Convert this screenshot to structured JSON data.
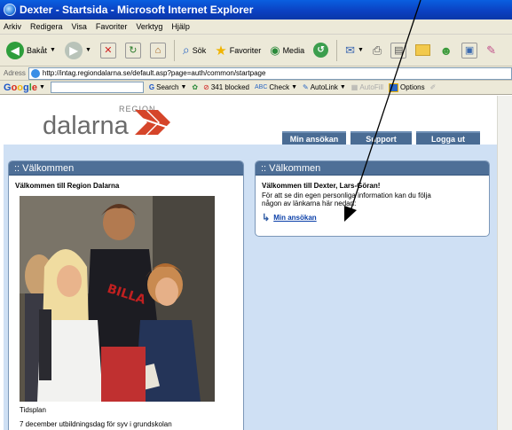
{
  "window": {
    "title": "Dexter - Startsida - Microsoft Internet Explorer"
  },
  "menu": [
    "Arkiv",
    "Redigera",
    "Visa",
    "Favoriter",
    "Verktyg",
    "Hjälp"
  ],
  "toolbar": {
    "back_label": "Bakåt",
    "search_label": "Sök",
    "favorites_label": "Favoriter",
    "media_label": "Media"
  },
  "address": {
    "label": "Adress",
    "url": "http://intag.regiondalarna.se/default.asp?page=auth/common/startpage"
  },
  "google_toolbar": {
    "logo": "Google",
    "search_label": "Search",
    "blocked_label": "341 blocked",
    "check_label": "Check",
    "autolink_label": "AutoLink",
    "autofill_label": "AutoFill",
    "options_label": "Options"
  },
  "site": {
    "logo_region": "REGION",
    "logo_name": "dalarna",
    "brand_color": "#d5452a",
    "nav": [
      "Min ansökan",
      "Support",
      "Logga ut"
    ]
  },
  "left_panel": {
    "title": ":: Välkommen",
    "heading": "Välkommen till Region Dalarna",
    "caption_1": "Tidsplan",
    "caption_2": "7 december utbildningsdag för syv i grundskolan"
  },
  "right_panel": {
    "title": ":: Välkommen",
    "heading": "Välkommen till Dexter, Lars-Göran!",
    "text_line1": "För att se din egen personliga information kan du följa",
    "text_line2": "någon av länkarna här nedan:",
    "link": "Min ansökan"
  }
}
